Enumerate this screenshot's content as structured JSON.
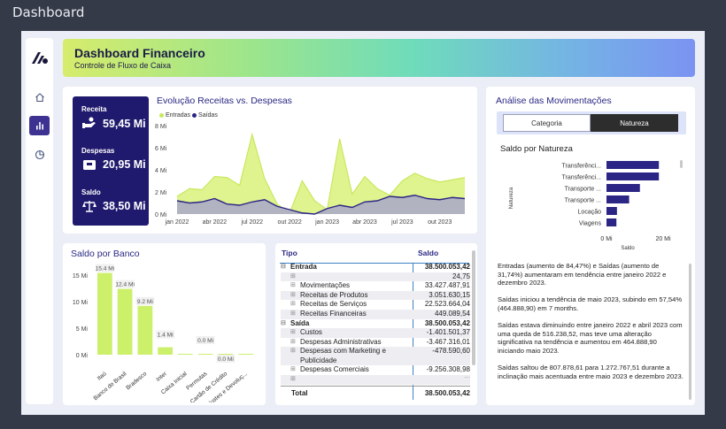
{
  "app": {
    "title": "Dashboard"
  },
  "header": {
    "title": "Dashboard Financeiro",
    "subtitle": "Controle de Fluxo de Caixa"
  },
  "nav": [
    {
      "icon": "home-icon"
    },
    {
      "icon": "bar-chart-icon",
      "active": true
    },
    {
      "icon": "pie-chart-icon"
    }
  ],
  "kpis": [
    {
      "label": "Receita",
      "value": "59,45 Mi",
      "icon": "money-hand-icon"
    },
    {
      "label": "Despesas",
      "value": "20,95 Mi",
      "icon": "wallet-icon"
    },
    {
      "label": "Saldo",
      "value": "38,50 Mi",
      "icon": "scale-icon"
    }
  ],
  "evolution": {
    "title": "Evolução Receitas vs. Despesas",
    "legend": [
      "Entradas",
      "Saídas"
    ],
    "colors": {
      "entradas": "#d6ef6a",
      "saidas": "#2b2585"
    }
  },
  "chart_data": [
    {
      "type": "area",
      "title": "Evolução Receitas vs. Despesas",
      "x_ticks": [
        "jan 2022",
        "abr 2022",
        "jul 2022",
        "out 2022",
        "jan 2023",
        "abr 2023",
        "jul 2023",
        "out 2023"
      ],
      "y_ticks": [
        "0 Mi",
        "2 Mi",
        "4 Mi",
        "6 Mi",
        "8 Mi"
      ],
      "ylim": [
        0,
        8
      ],
      "x": [
        "jan 2022",
        "fev 2022",
        "mar 2022",
        "abr 2022",
        "mai 2022",
        "jun 2022",
        "jul 2022",
        "ago 2022",
        "set 2022",
        "out 2022",
        "nov 2022",
        "dez 2022",
        "jan 2023",
        "fev 2023",
        "mar 2023",
        "abr 2023",
        "mai 2023",
        "jun 2023",
        "jul 2023",
        "ago 2023",
        "set 2023",
        "out 2023",
        "nov 2023",
        "dez 2023"
      ],
      "series": [
        {
          "name": "Entradas",
          "values": [
            1.6,
            2.3,
            2.2,
            3.4,
            3.3,
            2.6,
            7.2,
            3.2,
            0.9,
            0.1,
            3.0,
            1.2,
            0.4,
            6.8,
            1.8,
            3.4,
            2.3,
            1.7,
            3.0,
            3.7,
            3.2,
            2.9,
            3.1,
            3.3
          ]
        },
        {
          "name": "Saídas",
          "values": [
            1.2,
            1.0,
            1.1,
            1.4,
            0.9,
            0.8,
            1.1,
            1.3,
            0.7,
            0.4,
            0.1,
            0.0,
            0.5,
            0.8,
            0.6,
            1.1,
            1.2,
            1.6,
            1.5,
            1.7,
            1.4,
            1.3,
            1.5,
            1.4
          ]
        }
      ]
    },
    {
      "type": "bar",
      "title": "Saldo por Banco",
      "categories": [
        "Itaú",
        "Banco do Brasil",
        "Bradesco",
        "Inter",
        "Caixa Inicial",
        "Permutas",
        "Cartão de Crédito",
        "Ajustes e Devoluç..."
      ],
      "values": [
        15.4,
        12.4,
        9.2,
        1.4,
        0.0,
        0.0,
        0.0,
        0.0
      ],
      "data_labels": [
        "15.4 Mi",
        "12.4 Mi",
        "9.2 Mi",
        "1.4 Mi",
        "",
        "0.0 Mi",
        "0.0 Mi",
        ""
      ],
      "y_ticks": [
        "0 Mi",
        "5 Mi",
        "10 Mi",
        "15 Mi"
      ],
      "ylim": [
        0,
        16
      ],
      "color": "#ccf06a"
    },
    {
      "type": "bar",
      "orientation": "horizontal",
      "title": "Saldo por Natureza",
      "categories": [
        "Transferênci...",
        "Transferênci...",
        "Transporte ...",
        "Transporte ...",
        "Locação",
        "Viagens"
      ],
      "values": [
        18.5,
        18.5,
        11.8,
        8.0,
        3.7,
        3.5
      ],
      "xlim": [
        0,
        20
      ],
      "x_ticks": [
        "0 Mi",
        "20 Mi"
      ],
      "xlabel": "Saldo",
      "ylabel": "Natureza",
      "color": "#2b2585"
    }
  ],
  "bank": {
    "title": "Saldo por Banco",
    "color": "#ccf06a"
  },
  "table": {
    "headers": [
      "Tipo",
      "Saldo"
    ],
    "rows": [
      {
        "label": "Entrada",
        "value": "38.500.053,42",
        "level": 0,
        "bold": true,
        "expander": "⊟"
      },
      {
        "label": "",
        "value": "24,75",
        "level": 1,
        "expander": "⊞"
      },
      {
        "label": "Movimentações",
        "value": "33.427.487,91",
        "level": 1,
        "expander": "⊞"
      },
      {
        "label": "Receitas de Produtos",
        "value": "3.051.630,15",
        "level": 1,
        "expander": "⊞"
      },
      {
        "label": "Receitas de Serviços",
        "value": "22.523.664,04",
        "level": 1,
        "expander": "⊞"
      },
      {
        "label": "Receitas Financeiras",
        "value": "449.089,54",
        "level": 1,
        "expander": "⊞"
      },
      {
        "label": "Saída",
        "value": "38.500.053,42",
        "level": 0,
        "bold": true,
        "expander": "⊟"
      },
      {
        "label": "Custos",
        "value": "-1.401.501,37",
        "level": 1,
        "expander": "⊞"
      },
      {
        "label": "Despesas Administrativas",
        "value": "-3.467.316,01",
        "level": 1,
        "expander": "⊞"
      },
      {
        "label": "Despesas com Marketing e Publicidade",
        "value": "-478.590,60",
        "level": 1,
        "expander": "⊞",
        "wrap": true
      },
      {
        "label": "Despesas Comerciais",
        "value": "-9.256.308,98",
        "level": 1,
        "expander": "⊞"
      },
      {
        "label": "",
        "value": "...",
        "level": 1,
        "expander": "⊞",
        "partial": true
      }
    ],
    "total_label": "Total",
    "total_value": "38.500.053,42"
  },
  "analysis": {
    "title": "Análise das Movimentações",
    "tabs": [
      "Categoria",
      "Natureza"
    ],
    "active_tab": "Natureza",
    "chart_title": "Saldo por Natureza",
    "text": [
      "Entradas (aumento de 84,47%) e Saídas (aumento de 31,74%) aumentaram em tendência entre janeiro 2022 e dezembro 2023.",
      "Saídas iniciou a tendência de maio 2023, subindo em 57,54% (464.888,90) em 7 months.",
      "Saídas estava diminuindo entre janeiro 2022 e abril 2023 com uma queda de 516.238,52, mas teve uma alteração significativa na tendência e aumentou em 464.888,90 iniciando maio 2023.",
      "Saídas saltou de 807.878,61 para 1.272.767,51 durante a inclinação mais acentuada entre maio 2023 e dezembro 2023."
    ]
  }
}
